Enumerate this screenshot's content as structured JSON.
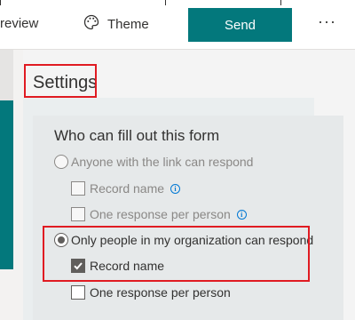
{
  "toolbar": {
    "preview_label": "review",
    "theme_label": "Theme",
    "send_label": "Send",
    "more_label": "···"
  },
  "settings": {
    "title": "Settings",
    "section_title": "Who can fill out this form",
    "options": [
      {
        "label": "Anyone with the link can respond",
        "selected": false,
        "sub_options": [
          {
            "label": "Record name",
            "checked": false,
            "enabled": false,
            "info": true
          },
          {
            "label": "One response per person",
            "checked": false,
            "enabled": false,
            "info": true
          }
        ]
      },
      {
        "label": "Only people in my organization can respond",
        "selected": true,
        "sub_options": [
          {
            "label": "Record name",
            "checked": true,
            "enabled": true,
            "info": false
          },
          {
            "label": "One response per person",
            "checked": false,
            "enabled": true,
            "info": false
          }
        ]
      }
    ]
  },
  "colors": {
    "accent": "#03787c",
    "highlight": "#e01b22",
    "info": "#0078d4"
  }
}
